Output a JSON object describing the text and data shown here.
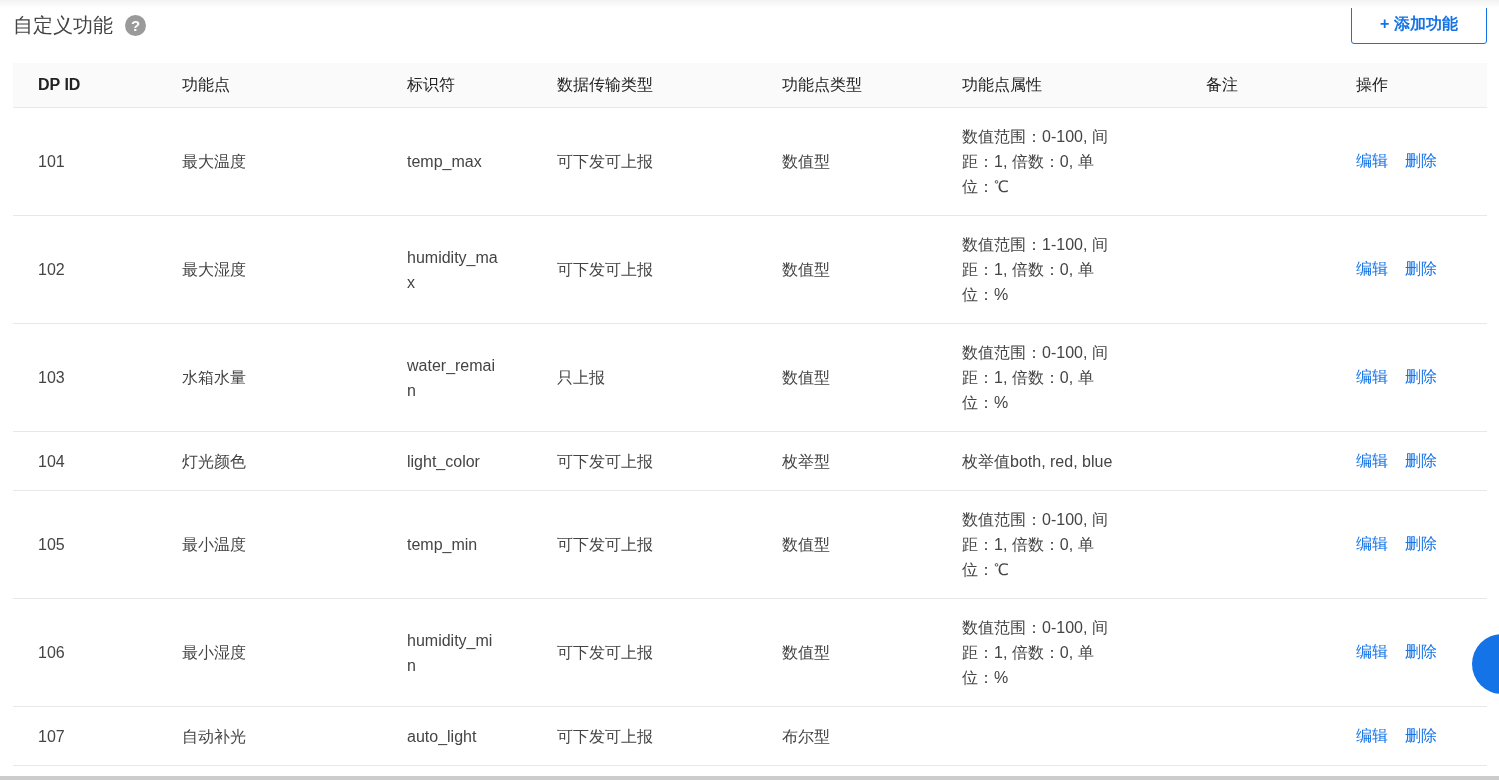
{
  "section": {
    "title": "自定义功能",
    "help_icon": "?"
  },
  "add_button": {
    "label": "+ 添加功能"
  },
  "table": {
    "columns": [
      "DP ID",
      "功能点",
      "标识符",
      "数据传输类型",
      "功能点类型",
      "功能点属性",
      "备注",
      "操作"
    ],
    "rows": [
      {
        "id": "101",
        "name": "最大温度",
        "identifier": "temp_max",
        "transfer": "可下发可上报",
        "type": "数值型",
        "attributes": "数值范围：0-100, 间距：1, 倍数：0, 单位：℃",
        "actions": [
          "编辑",
          "删除"
        ]
      },
      {
        "id": "102",
        "name": "最大湿度",
        "identifier": "humidity_max",
        "transfer": "可下发可上报",
        "type": "数值型",
        "attributes": "数值范围：1-100, 间距：1, 倍数：0, 单位：%",
        "actions": [
          "编辑",
          "删除"
        ]
      },
      {
        "id": "103",
        "name": "水箱水量",
        "identifier": "water_remain",
        "transfer": "只上报",
        "type": "数值型",
        "attributes": "数值范围：0-100, 间距：1, 倍数：0, 单位：%",
        "actions": [
          "编辑",
          "删除"
        ]
      },
      {
        "id": "104",
        "name": "灯光颜色",
        "identifier": "light_color",
        "transfer": "可下发可上报",
        "type": "枚举型",
        "attributes": "枚举值both, red, blue",
        "actions": [
          "编辑",
          "删除"
        ]
      },
      {
        "id": "105",
        "name": "最小温度",
        "identifier": "temp_min",
        "transfer": "可下发可上报",
        "type": "数值型",
        "attributes": "数值范围：0-100, 间距：1, 倍数：0, 单位：℃",
        "actions": [
          "编辑",
          "删除"
        ]
      },
      {
        "id": "106",
        "name": "最小湿度",
        "identifier": "humidity_min",
        "transfer": "可下发可上报",
        "type": "数值型",
        "attributes": "数值范围：0-100, 间距：1, 倍数：0, 单位：%",
        "actions": [
          "编辑",
          "删除"
        ]
      },
      {
        "id": "107",
        "name": "自动补光",
        "identifier": "auto_light",
        "transfer": "可下发可上报",
        "type": "布尔型",
        "attributes": "",
        "actions": [
          "编辑",
          "删除"
        ]
      }
    ]
  }
}
